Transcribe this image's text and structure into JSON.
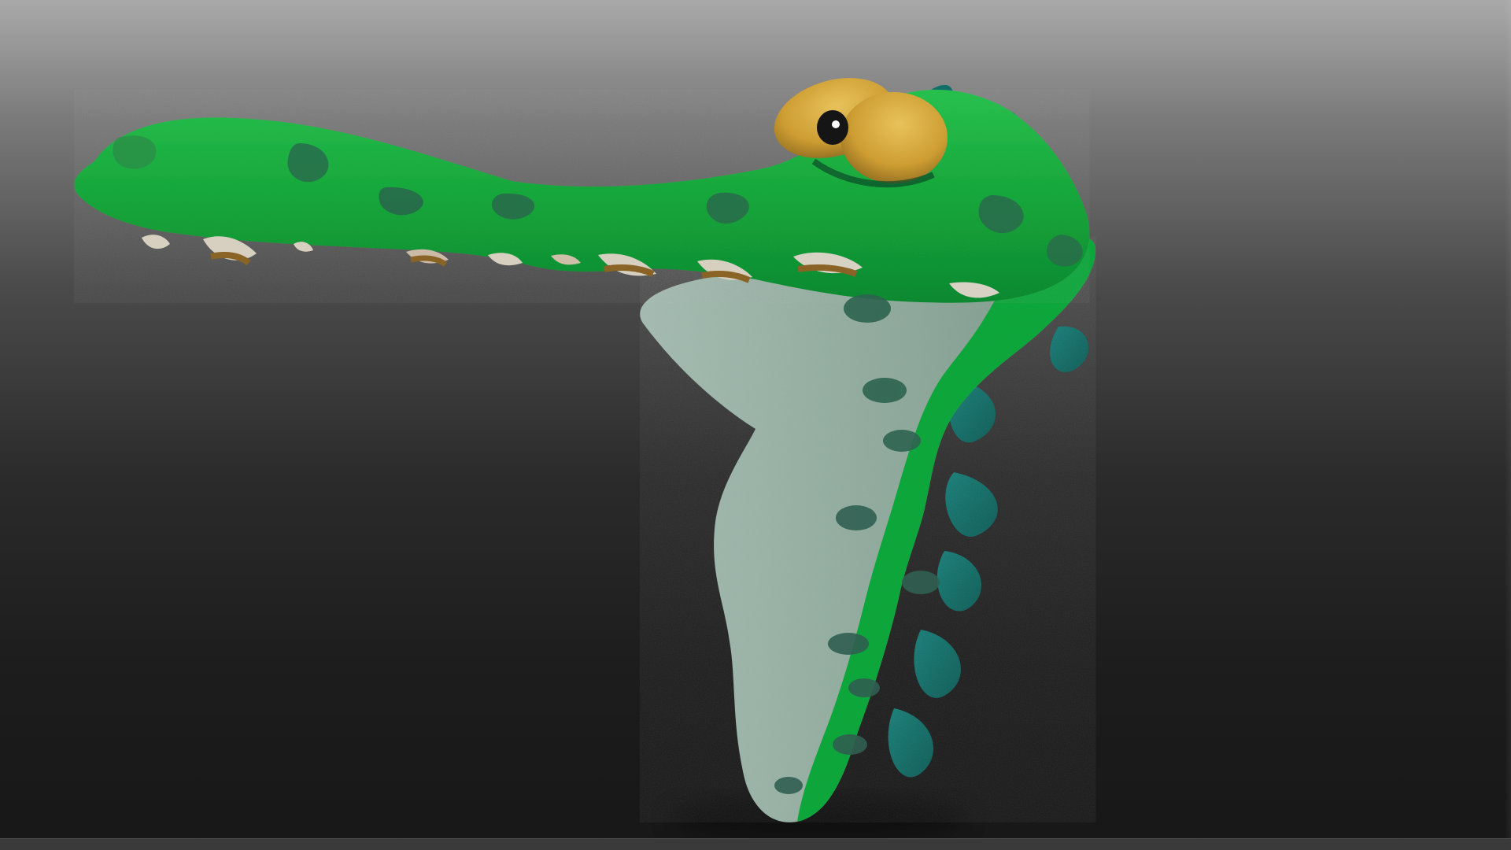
{
  "scene": {
    "subject": "crocodile-sculpt",
    "colors": {
      "background_top": "#a9a9a9",
      "background_bottom": "#171717",
      "body_green": "#16a83a",
      "belly": "#8ea79a",
      "spots": "#256b4b",
      "spines": "#0f6f67",
      "eyes": "#d4a63a",
      "pupil": "#1b1b1b",
      "teeth": "#d8d1c2",
      "gum_brown": "#8a6326"
    }
  }
}
